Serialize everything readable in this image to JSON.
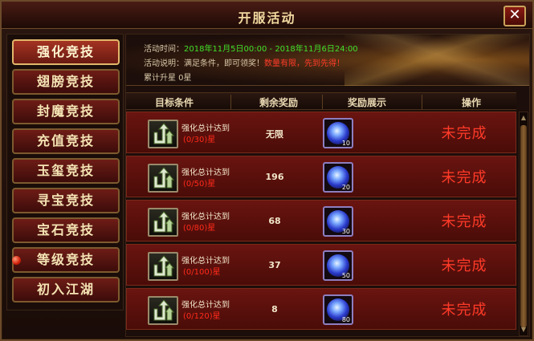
{
  "window": {
    "title": "开服活动",
    "close_label": "✕"
  },
  "sidebar": {
    "items": [
      {
        "label": "强化竞技",
        "active": true,
        "has_dot": false
      },
      {
        "label": "翅膀竞技",
        "active": false,
        "has_dot": false
      },
      {
        "label": "封魔竞技",
        "active": false,
        "has_dot": false
      },
      {
        "label": "充值竞技",
        "active": false,
        "has_dot": false
      },
      {
        "label": "玉玺竞技",
        "active": false,
        "has_dot": false
      },
      {
        "label": "寻宝竞技",
        "active": false,
        "has_dot": false
      },
      {
        "label": "宝石竞技",
        "active": false,
        "has_dot": false
      },
      {
        "label": "等级竞技",
        "active": false,
        "has_dot": true
      },
      {
        "label": "初入江湖",
        "active": false,
        "has_dot": false
      }
    ]
  },
  "info": {
    "time_label": "活动时间：",
    "time_value": "2018年11月5日00:00 - 2018年11月6日24:00",
    "desc_label": "活动说明：满足条件，即可领奖！",
    "desc_highlight": "数量有限，先到先得！",
    "total": "累计升星 0星"
  },
  "table": {
    "headers": [
      "目标条件",
      "剩余奖励",
      "奖励展示",
      "操作"
    ],
    "rows": [
      {
        "condition": "强化总计达到",
        "progress": "(0/30)星",
        "remaining": "无限",
        "qty": "10",
        "status": "未完成"
      },
      {
        "condition": "强化总计达到",
        "progress": "(0/50)星",
        "remaining": "196",
        "qty": "20",
        "status": "未完成"
      },
      {
        "condition": "强化总计达到",
        "progress": "(0/80)星",
        "remaining": "68",
        "qty": "30",
        "status": "未完成"
      },
      {
        "condition": "强化总计达到",
        "progress": "(0/100)星",
        "remaining": "37",
        "qty": "50",
        "status": "未完成"
      },
      {
        "condition": "强化总计达到",
        "progress": "(0/120)星",
        "remaining": "8",
        "qty": "80",
        "status": "未完成"
      }
    ]
  },
  "colors": {
    "accent_red": "#ff3a28",
    "time_green": "#3fe02a",
    "frame_gold": "#c9a25a"
  },
  "icons": {
    "task": "upgrade-arrows-icon",
    "reward": "blue-crystal-icon",
    "scroll_up": "scroll-up-arrow-icon",
    "scroll_down": "scroll-down-arrow-icon"
  }
}
